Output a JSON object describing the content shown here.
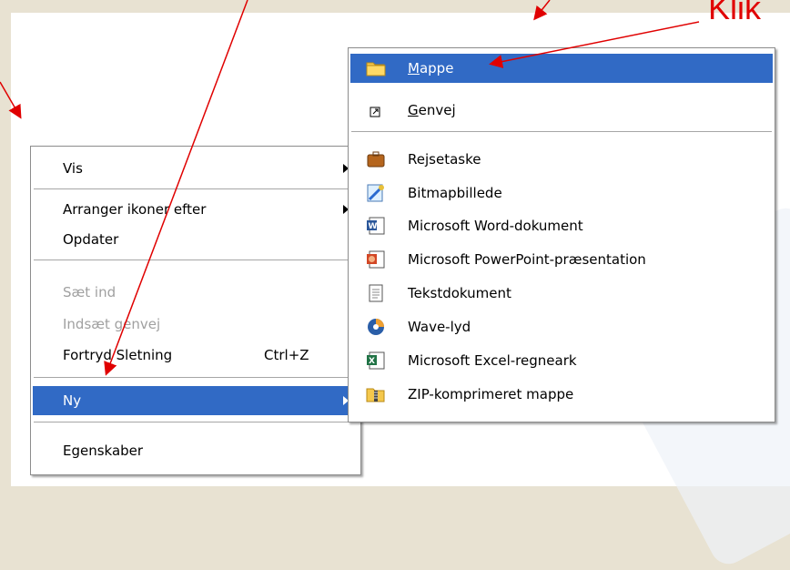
{
  "annotation": {
    "text": "Klik",
    "color": "#e00000"
  },
  "context_menu": {
    "items": [
      {
        "label": "Vis",
        "has_submenu": true
      },
      {
        "label": "Arranger ikoner efter",
        "has_submenu": true
      },
      {
        "label": "Opdater"
      },
      {
        "label": "Sæt ind",
        "disabled": true
      },
      {
        "label": "Indsæt genvej",
        "disabled": true
      },
      {
        "label": "Fortryd Sletning",
        "shortcut": "Ctrl+Z"
      },
      {
        "label": "Ny",
        "has_submenu": true,
        "selected": true
      },
      {
        "label": "Egenskaber"
      }
    ]
  },
  "new_submenu": {
    "items": [
      {
        "icon": "folder-icon",
        "label": "Mappe",
        "selected": true
      },
      {
        "icon": "shortcut-icon",
        "label": "Genvej"
      },
      {
        "icon": "briefcase-icon",
        "label": "Rejsetaske"
      },
      {
        "icon": "bitmap-icon",
        "label": "Bitmapbillede"
      },
      {
        "icon": "word-icon",
        "label": "Microsoft Word-dokument"
      },
      {
        "icon": "powerpoint-icon",
        "label": "Microsoft PowerPoint-præsentation"
      },
      {
        "icon": "text-document-icon",
        "label": "Tekstdokument"
      },
      {
        "icon": "wave-sound-icon",
        "label": "Wave-lyd"
      },
      {
        "icon": "excel-icon",
        "label": "Microsoft Excel-regneark"
      },
      {
        "icon": "zip-folder-icon",
        "label": "ZIP-komprimeret mappe"
      }
    ]
  },
  "colors": {
    "selection": "#316ac5",
    "arrow_red": "#e00000",
    "desktop_border": "#e8e2d2"
  }
}
